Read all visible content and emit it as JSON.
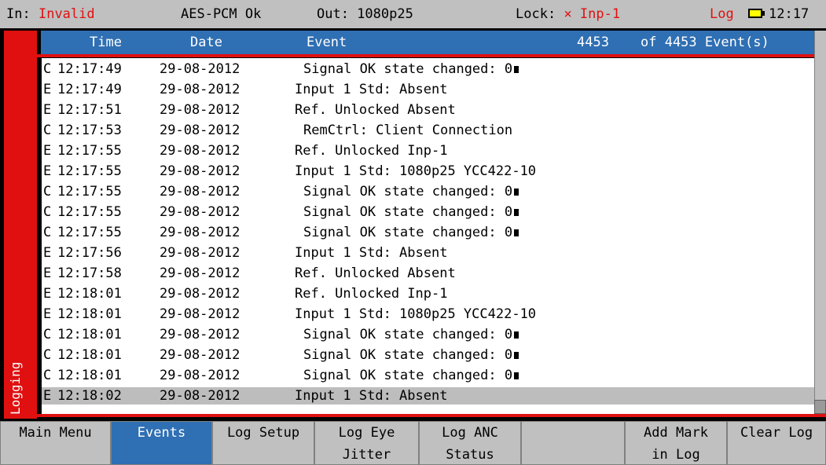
{
  "statusbar": {
    "in_label": "In:",
    "in_value": "Invalid",
    "audio": "AES-PCM Ok",
    "out": "Out: 1080p25",
    "lock_label": "Lock:",
    "lock_value": "× Inp-1",
    "log_label": "Log",
    "time": "12:17"
  },
  "sidetab": {
    "label": "Logging"
  },
  "header": {
    "time": "Time",
    "date": "Date",
    "event": "Event",
    "count": "4453",
    "of_total": "of 4453 Event(s)"
  },
  "events": [
    {
      "type": "C",
      "time": "12:17:49",
      "date": "29-08-2012",
      "text": "Signal OK state changed: 0",
      "indent": true,
      "marker": true
    },
    {
      "type": "E",
      "time": "12:17:49",
      "date": "29-08-2012",
      "text": "Input 1 Std: Absent",
      "indent": false,
      "marker": false
    },
    {
      "type": "E",
      "time": "12:17:51",
      "date": "29-08-2012",
      "text": "Ref. Unlocked Absent",
      "indent": false,
      "marker": false
    },
    {
      "type": "C",
      "time": "12:17:53",
      "date": "29-08-2012",
      "text": "RemCtrl: Client Connection",
      "indent": true,
      "marker": false
    },
    {
      "type": "E",
      "time": "12:17:55",
      "date": "29-08-2012",
      "text": "Ref. Unlocked Inp-1",
      "indent": false,
      "marker": false
    },
    {
      "type": "E",
      "time": "12:17:55",
      "date": "29-08-2012",
      "text": "Input 1 Std: 1080p25 YCC422-10",
      "indent": false,
      "marker": false
    },
    {
      "type": "C",
      "time": "12:17:55",
      "date": "29-08-2012",
      "text": "Signal OK state changed: 0",
      "indent": true,
      "marker": true
    },
    {
      "type": "C",
      "time": "12:17:55",
      "date": "29-08-2012",
      "text": "Signal OK state changed: 0",
      "indent": true,
      "marker": true
    },
    {
      "type": "C",
      "time": "12:17:55",
      "date": "29-08-2012",
      "text": "Signal OK state changed: 0",
      "indent": true,
      "marker": true
    },
    {
      "type": "E",
      "time": "12:17:56",
      "date": "29-08-2012",
      "text": "Input 1 Std: Absent",
      "indent": false,
      "marker": false
    },
    {
      "type": "E",
      "time": "12:17:58",
      "date": "29-08-2012",
      "text": "Ref. Unlocked Absent",
      "indent": false,
      "marker": false
    },
    {
      "type": "E",
      "time": "12:18:01",
      "date": "29-08-2012",
      "text": "Ref. Unlocked Inp-1",
      "indent": false,
      "marker": false
    },
    {
      "type": "E",
      "time": "12:18:01",
      "date": "29-08-2012",
      "text": "Input 1 Std: 1080p25 YCC422-10",
      "indent": false,
      "marker": false
    },
    {
      "type": "C",
      "time": "12:18:01",
      "date": "29-08-2012",
      "text": "Signal OK state changed: 0",
      "indent": true,
      "marker": true
    },
    {
      "type": "C",
      "time": "12:18:01",
      "date": "29-08-2012",
      "text": "Signal OK state changed: 0",
      "indent": true,
      "marker": true
    },
    {
      "type": "C",
      "time": "12:18:01",
      "date": "29-08-2012",
      "text": "Signal OK state changed: 0",
      "indent": true,
      "marker": true
    },
    {
      "type": "E",
      "time": "12:18:02",
      "date": "29-08-2012",
      "text": "Input 1 Std: Absent",
      "indent": false,
      "marker": false,
      "selected": true
    }
  ],
  "softkeys": [
    {
      "l1": "Main Menu",
      "l2": "",
      "active": false
    },
    {
      "l1": "Events",
      "l2": "",
      "active": true
    },
    {
      "l1": "Log Setup",
      "l2": "",
      "active": false
    },
    {
      "l1": "Log Eye",
      "l2": "Jitter",
      "active": false
    },
    {
      "l1": "Log ANC",
      "l2": "Status",
      "active": false
    },
    {
      "l1": "",
      "l2": "",
      "active": false
    },
    {
      "l1": "Add Mark",
      "l2": "in Log",
      "active": false
    },
    {
      "l1": "Clear Log",
      "l2": "",
      "active": false
    }
  ],
  "colors": {
    "accent_red": "#e01010",
    "header_blue": "#2f6fb3",
    "panel_grey": "#c0c0c0",
    "battery_yellow": "#ffff00"
  },
  "icons": {
    "battery": "battery-icon",
    "lock_state": "cross-icon"
  }
}
